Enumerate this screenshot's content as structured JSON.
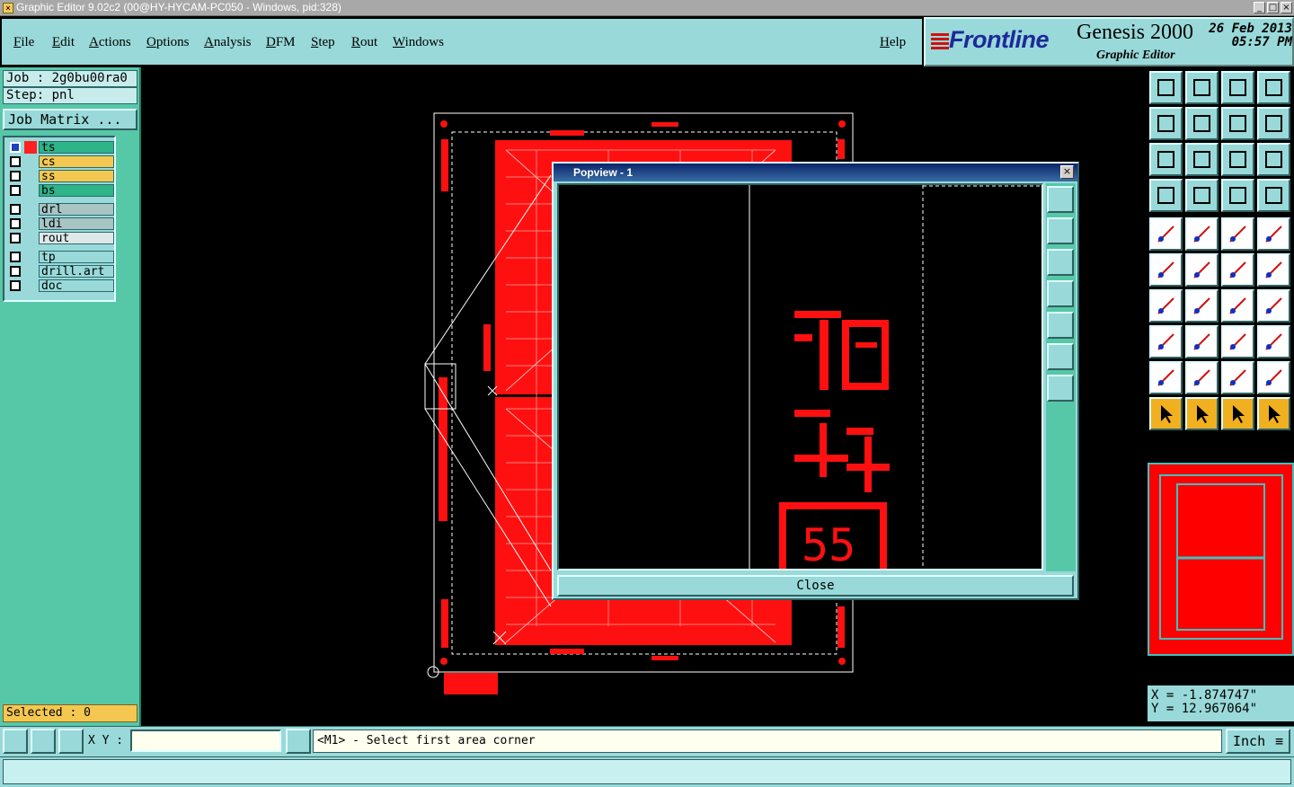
{
  "window": {
    "title": "Graphic Editor 9.02c2 (00@HY-HYCAM-PC050 - Windows, pid:328)"
  },
  "menu": [
    "File",
    "Edit",
    "Actions",
    "Options",
    "Analysis",
    "DFM",
    "Step",
    "Rout",
    "Windows",
    "Help"
  ],
  "branding": {
    "company": "Frontline",
    "product": "Genesis 2000",
    "subtitle": "Graphic Editor",
    "date": "26 Feb 2013",
    "time": "05:57 PM"
  },
  "job": {
    "job_label": "Job : 2g0bu00ra0",
    "step_label": "Step: pnl",
    "matrix_button": "Job Matrix ..."
  },
  "layers": [
    {
      "name": "ts",
      "color": "#2fb389",
      "swatch": "#ff2020",
      "active": true
    },
    {
      "name": "cs",
      "color": "#f4c850",
      "swatch": "",
      "active": false
    },
    {
      "name": "ss",
      "color": "#f4c850",
      "swatch": "",
      "active": false
    },
    {
      "name": "bs",
      "color": "#2fb389",
      "swatch": "",
      "active": false
    },
    {
      "name": "drl",
      "color": "#a8c4c4",
      "swatch": "",
      "active": false
    },
    {
      "name": "ldi",
      "color": "#a8c4c4",
      "swatch": "",
      "active": false
    },
    {
      "name": "rout",
      "color": "#dfe8e8",
      "swatch": "",
      "active": false
    },
    {
      "name": "tp",
      "color": "#99d9d9",
      "swatch": "",
      "active": false
    },
    {
      "name": "drill.art",
      "color": "#99d9d9",
      "swatch": "",
      "active": false
    },
    {
      "name": "doc",
      "color": "#99d9d9",
      "swatch": "",
      "active": false
    }
  ],
  "selected_label": "Selected : 0",
  "coords": {
    "x": "X = -1.874747\"",
    "y": "Y = 12.967064\""
  },
  "bottom": {
    "xy_label": "X Y :",
    "xy_value": "",
    "prompt": "<M1> - Select first area corner",
    "units": "Inch"
  },
  "popview": {
    "title": "Popview - 1",
    "close_label": "Close",
    "glyph_text": "55"
  },
  "toolbar_icons": [
    "home-icon",
    "zoom-icon",
    "house-icon",
    "split-icon",
    "left-icon",
    "right-icon",
    "undo-icon",
    "redo-icon",
    "fit-icon",
    "center-icon",
    "ratio-icon",
    "help-icon",
    "tools-icon",
    "grid-icon",
    "snap-icon",
    "snap2-icon",
    "select-icon",
    "draw-icon",
    "ruler-icon",
    "pad-icon",
    "connect-icon",
    "cross-icon",
    "line-icon",
    "line2-icon",
    "angle-icon",
    "slash-icon",
    "arc-icon",
    "flip-icon",
    "feature-icon",
    "minus-icon",
    "measure-icon",
    "shapes-icon",
    "tri-icon",
    "tri2-icon",
    "tri3-icon",
    "tri4-icon",
    "pointer-icon",
    "pointer2-icon",
    "pointer3-icon",
    "pointer4-icon"
  ]
}
